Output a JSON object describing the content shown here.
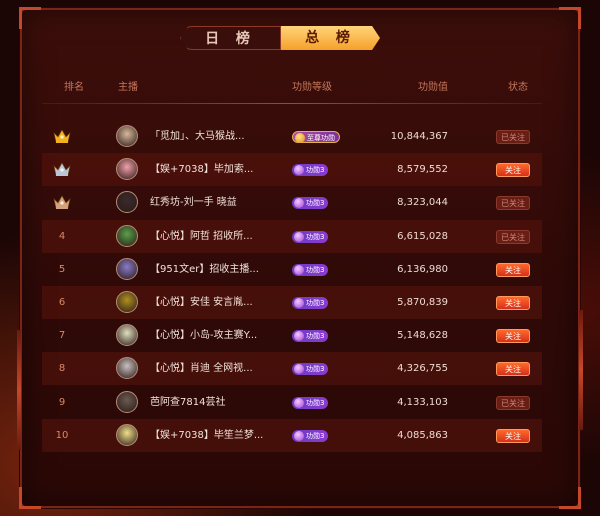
{
  "tabs": {
    "daily": "日 榜",
    "total": "总 榜",
    "active": "total"
  },
  "columns": {
    "rank": "排名",
    "host": "主播",
    "level": "功勋等级",
    "value": "功勋值",
    "status": "状态"
  },
  "colors": {
    "accent": "#f5a12a",
    "follow": "#e0401f",
    "followed": "#6a1d14",
    "crown_gold": "#f2b21e",
    "crown_silver": "#b8c6d6",
    "crown_bronze": "#d2a07a"
  },
  "rows": [
    {
      "rank": "1",
      "crown": "gold",
      "avatar": "avatar-1",
      "name": "「觅加」、大马猴战...",
      "level": "至尊功勋",
      "level_style": "gold",
      "value": "10,844,367",
      "status": "已关注",
      "followed": true
    },
    {
      "rank": "2",
      "crown": "silver",
      "avatar": "avatar-2",
      "name": "【娱+7038】毕加索...",
      "level": "功勋3",
      "level_style": "purple",
      "value": "8,579,552",
      "status": "关注",
      "followed": false
    },
    {
      "rank": "3",
      "crown": "bronze",
      "avatar": "avatar-3",
      "name": "红秀坊-刘一手 晓益",
      "level": "功勋3",
      "level_style": "purple",
      "value": "8,323,044",
      "status": "已关注",
      "followed": true
    },
    {
      "rank": "4",
      "crown": "",
      "avatar": "avatar-4",
      "name": "【心悦】阿哲 招收所...",
      "level": "功勋3",
      "level_style": "purple",
      "value": "6,615,028",
      "status": "已关注",
      "followed": true
    },
    {
      "rank": "5",
      "crown": "",
      "avatar": "avatar-5",
      "name": "【951文er】招收主播...",
      "level": "功勋3",
      "level_style": "purple",
      "value": "6,136,980",
      "status": "关注",
      "followed": false
    },
    {
      "rank": "6",
      "crown": "",
      "avatar": "avatar-6",
      "name": "【心悦】安佳 安言胤...",
      "level": "功勋3",
      "level_style": "purple",
      "value": "5,870,839",
      "status": "关注",
      "followed": false
    },
    {
      "rank": "7",
      "crown": "",
      "avatar": "avatar-7",
      "name": "【心悦】小岛-攻主赛Y...",
      "level": "功勋3",
      "level_style": "purple",
      "value": "5,148,628",
      "status": "关注",
      "followed": false
    },
    {
      "rank": "8",
      "crown": "",
      "avatar": "avatar-8",
      "name": "【心悦】肖迪 全网视...",
      "level": "功勋3",
      "level_style": "purple",
      "value": "4,326,755",
      "status": "关注",
      "followed": false
    },
    {
      "rank": "9",
      "crown": "",
      "avatar": "avatar-9",
      "name": "芭阿查7814芸社",
      "level": "功勋3",
      "level_style": "purple",
      "value": "4,133,103",
      "status": "已关注",
      "followed": true
    },
    {
      "rank": "10",
      "crown": "",
      "avatar": "avatar-10",
      "name": "【娱+7038】毕笙兰梦...",
      "level": "功勋3",
      "level_style": "purple",
      "value": "4,085,863",
      "status": "关注",
      "followed": false
    }
  ]
}
